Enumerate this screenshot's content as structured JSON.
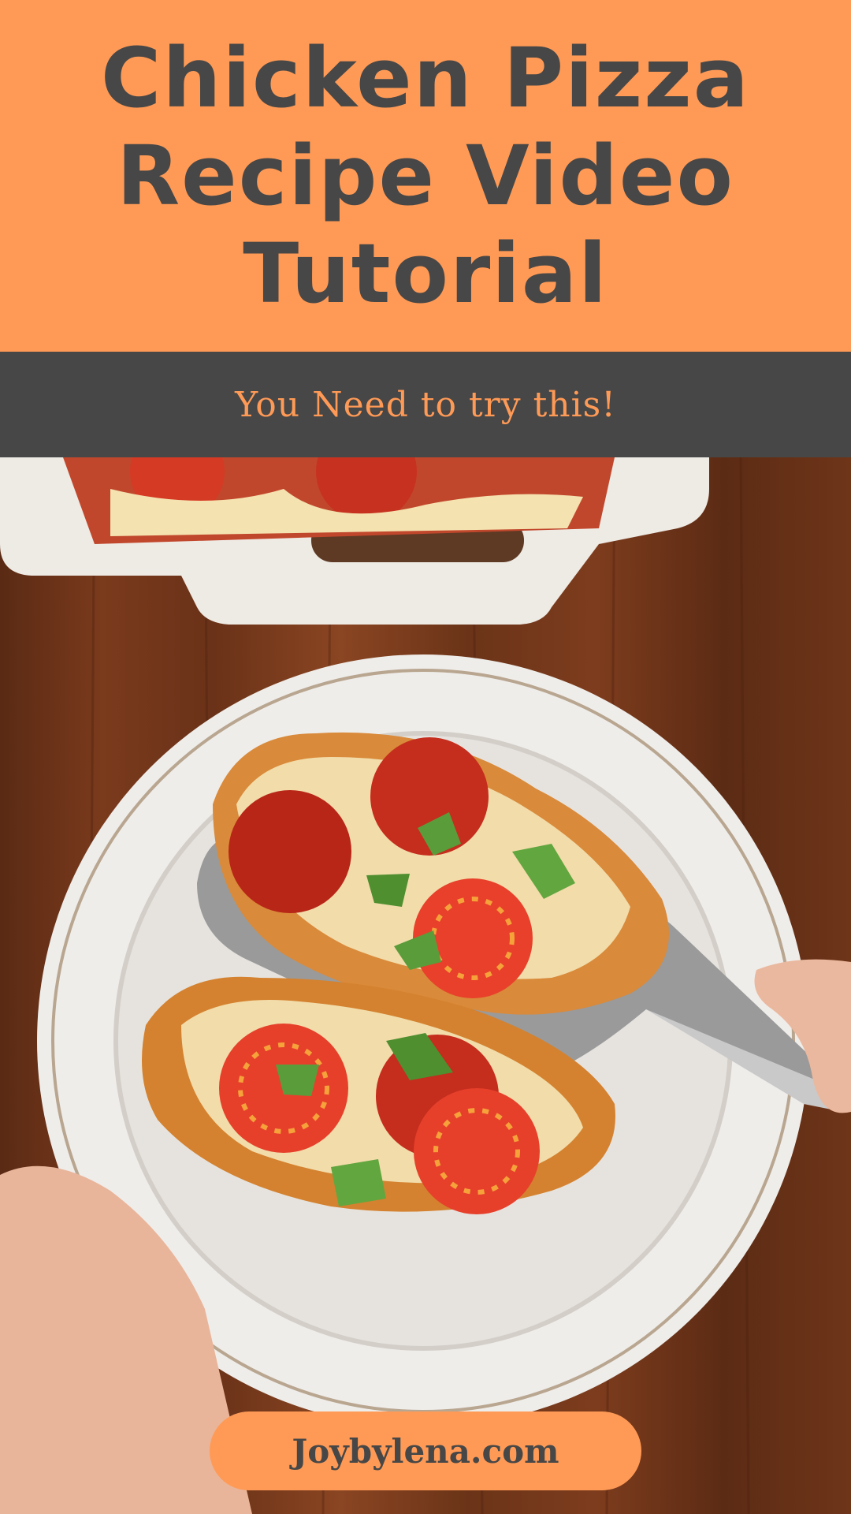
{
  "header": {
    "title": "Chicken Pizza Recipe Video Tutorial",
    "background_color": "#FF9A56",
    "text_color": "#474747"
  },
  "subheader": {
    "text": "You Need to try this!",
    "background_color": "#474747",
    "text_color": "#FF9A56"
  },
  "photo": {
    "icon": "food-photo"
  },
  "footer": {
    "website": "Joybylena.com"
  }
}
